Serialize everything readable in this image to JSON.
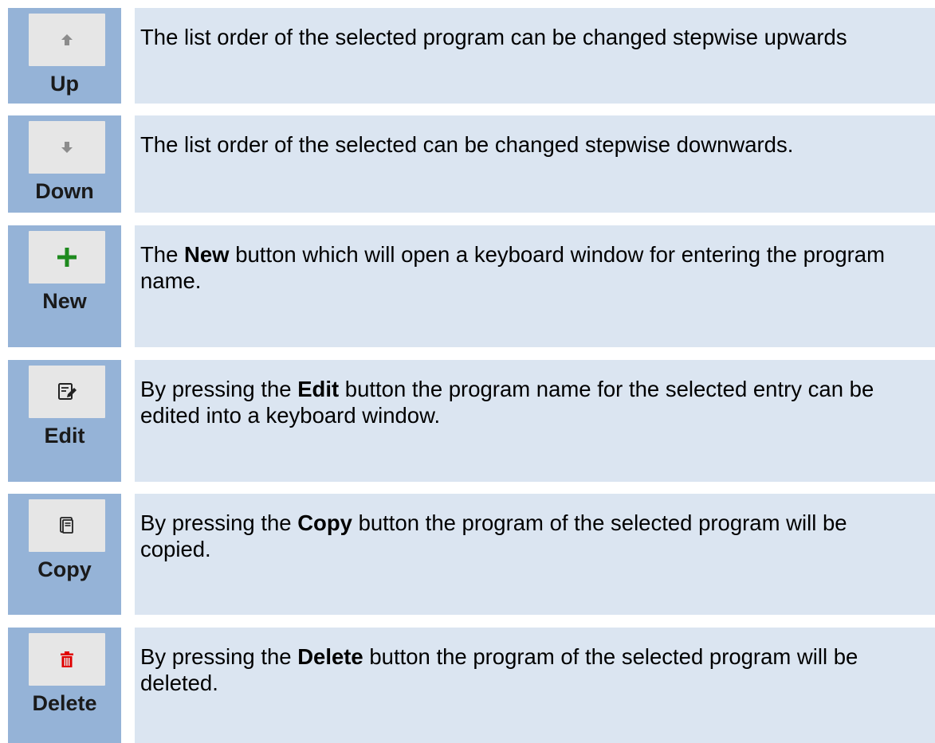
{
  "rows": [
    {
      "label": "Up",
      "icon": "arrow-up-icon",
      "text_pre": "The list order of the selected program can be changed stepwise upwards",
      "text_bold": "",
      "text_post": ""
    },
    {
      "label": "Down",
      "icon": "arrow-down-icon",
      "text_pre": "The list order of the selected can be changed stepwise downwards.",
      "text_bold": "",
      "text_post": ""
    },
    {
      "label": "New",
      "icon": "plus-icon",
      "text_pre": "The ",
      "text_bold": "New",
      "text_post": " button which will open a keyboard window for entering the program name."
    },
    {
      "label": "Edit",
      "icon": "edit-icon",
      "text_pre": "By pressing the ",
      "text_bold": "Edit",
      "text_post": " button the program name for the selected entry can be edited into a keyboard window."
    },
    {
      "label": "Copy",
      "icon": "copy-icon",
      "text_pre": "By pressing the ",
      "text_bold": "Copy",
      "text_post": " button the program of the selected program will be copied."
    },
    {
      "label": "Delete",
      "icon": "trash-icon",
      "text_pre": "By pressing the ",
      "text_bold": "Delete",
      "text_post": " button the program of the selected program will be deleted."
    }
  ],
  "colors": {
    "icon_column": "#95b3d7",
    "description_column": "#dbe5f1",
    "plus_icon": "#1e8a1e",
    "trash_icon": "#e00000"
  }
}
